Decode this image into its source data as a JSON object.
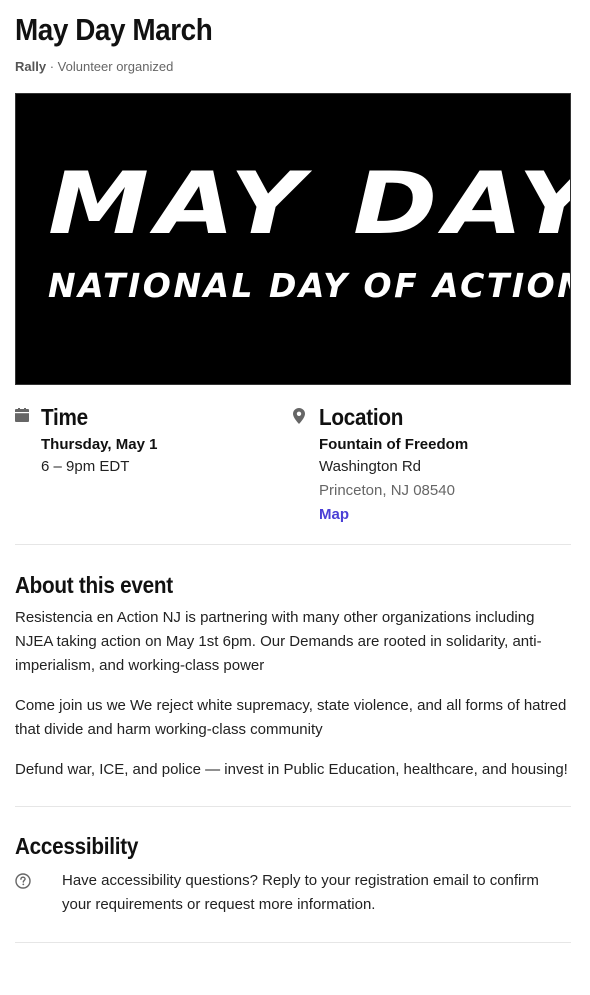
{
  "event": {
    "title": "May Day March",
    "type": "Rally",
    "organizer": "Volunteer organized"
  },
  "banner": {
    "line1": "MAY DAY",
    "line2": "NATIONAL DAY OF ACTION"
  },
  "time": {
    "heading": "Time",
    "date": "Thursday, May 1",
    "hours": "6 – 9pm EDT",
    "icon": "calendar-icon"
  },
  "location": {
    "heading": "Location",
    "venue": "Fountain of Freedom",
    "street": "Washington Rd",
    "city": "Princeton, NJ 08540",
    "map_link": "Map",
    "icon": "map-pin-icon"
  },
  "about": {
    "heading": "About this event",
    "paragraphs": [
      "Resistencia en Action NJ is partnering with many other organizations including NJEA taking action on May 1st 6pm. Our Demands are rooted in solidarity, anti-imperialism, and working-class power",
      "Come join us we We reject white supremacy, state violence, and all forms of hatred that divide and harm working-class community",
      "Defund war, ICE, and police — invest in Public Education, healthcare, and housing!"
    ]
  },
  "accessibility": {
    "heading": "Accessibility",
    "text": "Have accessibility questions? Reply to your registration email to confirm your requirements or request more information.",
    "icon": "question-circle-icon"
  },
  "colors": {
    "link": "#4b3fd6",
    "icon_gray": "#666666",
    "banner_bg": "#000000"
  }
}
